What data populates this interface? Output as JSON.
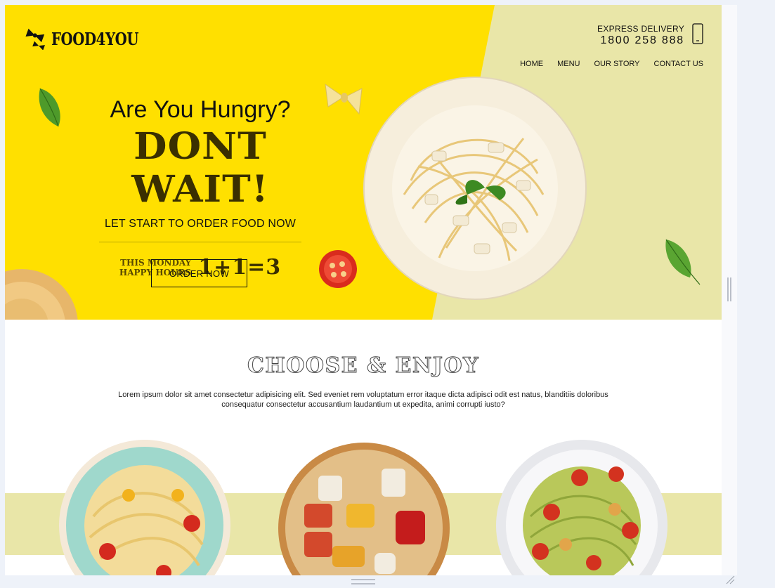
{
  "brand": {
    "name": "FOOD4YOU"
  },
  "header": {
    "express_label": "EXPRESS DELIVERY",
    "express_phone": "1800 258 888",
    "nav": [
      {
        "label": "HOME"
      },
      {
        "label": "MENU"
      },
      {
        "label": "OUR STORY"
      },
      {
        "label": "CONTACT US"
      }
    ]
  },
  "hero": {
    "subtitle": "Are You Hungry?",
    "title": "DONT WAIT!",
    "tagline": "LET START TO ORDER FOOD NOW",
    "promo_line1": "THIS MONDAY",
    "promo_line2": "HAPPY HOURS",
    "promo_offer": "1+1=3",
    "cta_label": "ORDER NOW"
  },
  "section": {
    "title": "CHOOSE & ENJOY",
    "description": "Lorem ipsum dolor sit amet consectetur adipisicing elit. Sed eveniet rem voluptatum error itaque dicta adipisci odit est natus, blanditiis doloribus consequatur consectetur accusantium laudantium ut expedita, animi corrupti iusto?"
  },
  "colors": {
    "hero_yellow": "#ffe000",
    "hero_cream": "#e9e6a8",
    "band": "#e9e6a8",
    "text": "#111111"
  },
  "icons": [
    "logo-pasta-icon",
    "phone-icon",
    "grip-icon"
  ]
}
